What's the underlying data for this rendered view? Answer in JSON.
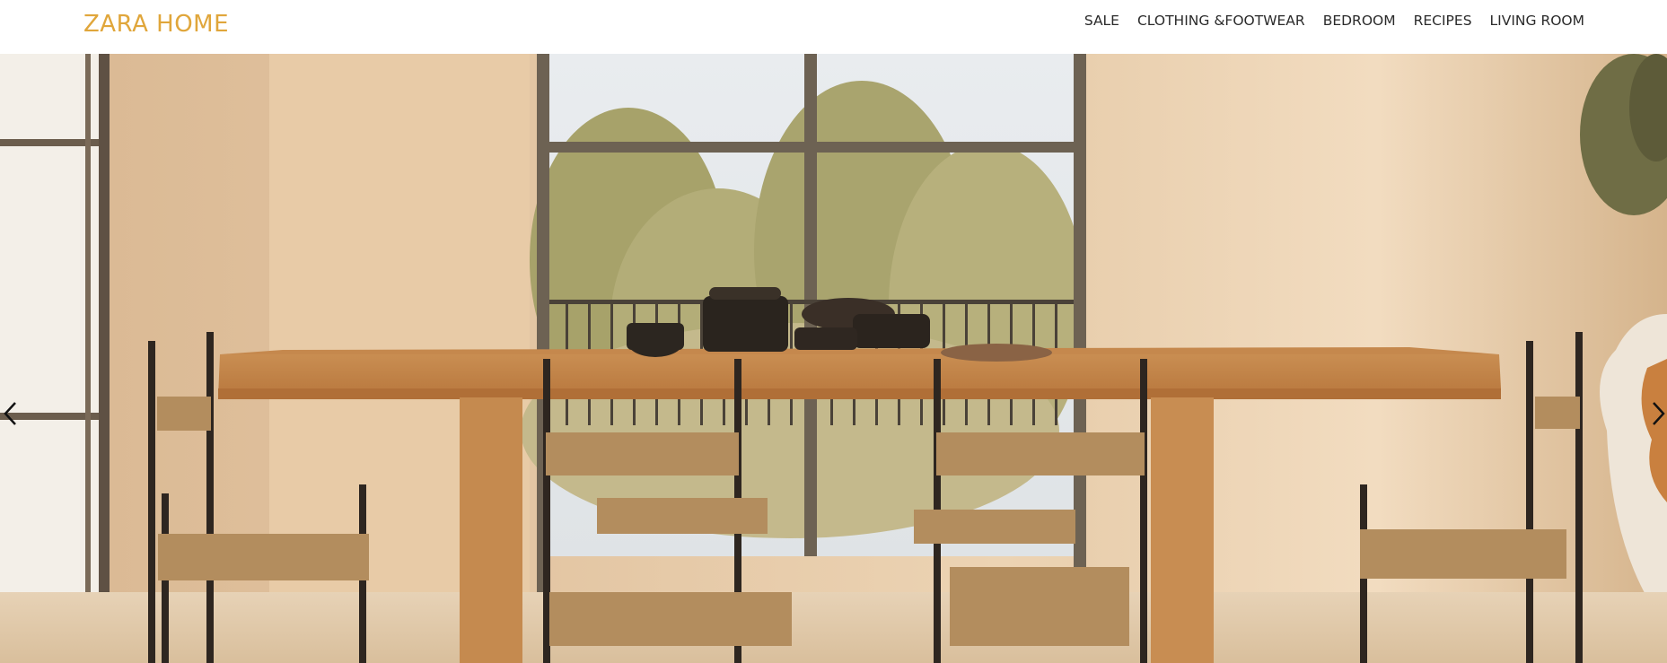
{
  "brand": {
    "name": "ZARA HOME"
  },
  "nav": {
    "items": [
      {
        "label": "SALE"
      },
      {
        "label": "CLOTHING &FOOTWEAR"
      },
      {
        "label": "BEDROOM"
      },
      {
        "label": "RECIPES"
      },
      {
        "label": "LIVING ROOM"
      }
    ]
  },
  "hero": {
    "image": "dining-room-photo",
    "prev_icon": "chevron-left-icon",
    "next_icon": "chevron-right-icon"
  },
  "colors": {
    "brand": "#e0a63b",
    "nav_text": "#2b2b2b",
    "header_bg": "#ffffff"
  }
}
